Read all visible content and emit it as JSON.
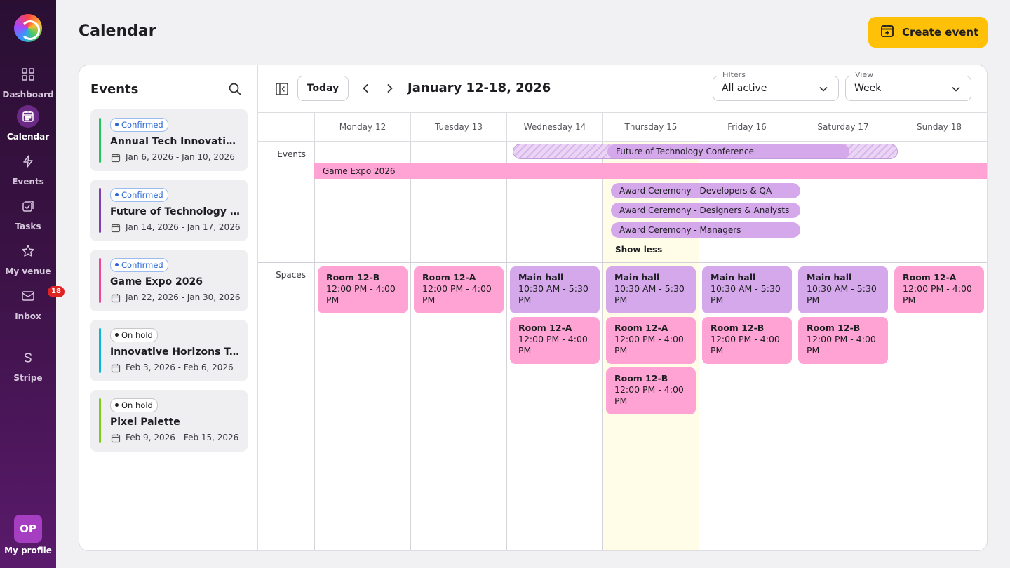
{
  "sidebar": {
    "items": [
      {
        "label": "Dashboard",
        "icon": "grid-icon"
      },
      {
        "label": "Calendar",
        "icon": "calendar-icon"
      },
      {
        "label": "Events",
        "icon": "lightning-icon"
      },
      {
        "label": "Tasks",
        "icon": "task-icon"
      },
      {
        "label": "My venue",
        "icon": "star-icon"
      },
      {
        "label": "Inbox",
        "icon": "inbox-icon",
        "badge": "18"
      },
      {
        "label": "Stripe",
        "icon": "stripe-icon"
      }
    ],
    "profile": {
      "initials": "OP",
      "label": "My profile"
    }
  },
  "header": {
    "title": "Calendar",
    "create_label": "Create event"
  },
  "events_panel": {
    "title": "Events",
    "items": [
      {
        "status": "Confirmed",
        "name": "Annual Tech Innovation Summit",
        "dates": "Jan 6, 2026 - Jan 10, 2026",
        "color": "#22c55e"
      },
      {
        "status": "Confirmed",
        "name": "Future of Technology Conference",
        "dates": "Jan 14, 2026 - Jan 17, 2026",
        "color": "#7e3fb3"
      },
      {
        "status": "Confirmed",
        "name": "Game Expo 2026",
        "dates": "Jan 22, 2026 - Jan 30, 2026",
        "color": "#ec4899"
      },
      {
        "status": "On hold",
        "name": "Innovative Horizons Technology Forum",
        "dates": "Feb 3, 2026 - Feb 6, 2026",
        "color": "#0ab7d6"
      },
      {
        "status": "On hold",
        "name": "Pixel Palette",
        "dates": "Feb 9, 2026 - Feb 15, 2026",
        "color": "#7ccc1c"
      }
    ]
  },
  "toolbar": {
    "today_label": "Today",
    "range": "January 12-18, 2026",
    "filters": {
      "label": "Filters",
      "value": "All active"
    },
    "view": {
      "label": "View",
      "value": "Week"
    }
  },
  "days": [
    "Monday 12",
    "Tuesday 13",
    "Wednesday 14",
    "Thursday 15",
    "Friday 16",
    "Saturday 17",
    "Sunday 18"
  ],
  "rows": {
    "events": "Events",
    "spaces": "Spaces"
  },
  "event_bars": {
    "future": "Future of Technology Conference",
    "expo": "Game Expo 2026",
    "award1": "Award Ceremony - Developers & QA",
    "award2": "Award Ceremony - Designers & Analysts",
    "award3": "Award Ceremony - Managers",
    "show_less": "Show less"
  },
  "spaces": [
    [
      {
        "name": "Room 12-B",
        "time": "12:00 PM - 4:00 PM",
        "color": "pink"
      }
    ],
    [
      {
        "name": "Room 12-A",
        "time": "12:00 PM - 4:00 PM",
        "color": "pink"
      }
    ],
    [
      {
        "name": "Main hall",
        "time": "10:30 AM - 5:30 PM",
        "color": "purple"
      },
      {
        "name": "Room 12-A",
        "time": "12:00 PM - 4:00 PM",
        "color": "pink"
      }
    ],
    [
      {
        "name": "Main hall",
        "time": "10:30 AM - 5:30 PM",
        "color": "purple"
      },
      {
        "name": "Room 12-A",
        "time": "12:00 PM - 4:00 PM",
        "color": "pink"
      },
      {
        "name": "Room 12-B",
        "time": "12:00 PM - 4:00 PM",
        "color": "pink"
      }
    ],
    [
      {
        "name": "Main hall",
        "time": "10:30 AM - 5:30 PM",
        "color": "purple"
      },
      {
        "name": "Room 12-B",
        "time": "12:00 PM - 4:00 PM",
        "color": "pink"
      }
    ],
    [
      {
        "name": "Main hall",
        "time": "10:30 AM - 5:30 PM",
        "color": "purple"
      },
      {
        "name": "Room 12-B",
        "time": "12:00 PM - 4:00 PM",
        "color": "pink"
      }
    ],
    [
      {
        "name": "Room 12-A",
        "time": "12:00 PM - 4:00 PM",
        "color": "pink"
      }
    ]
  ]
}
